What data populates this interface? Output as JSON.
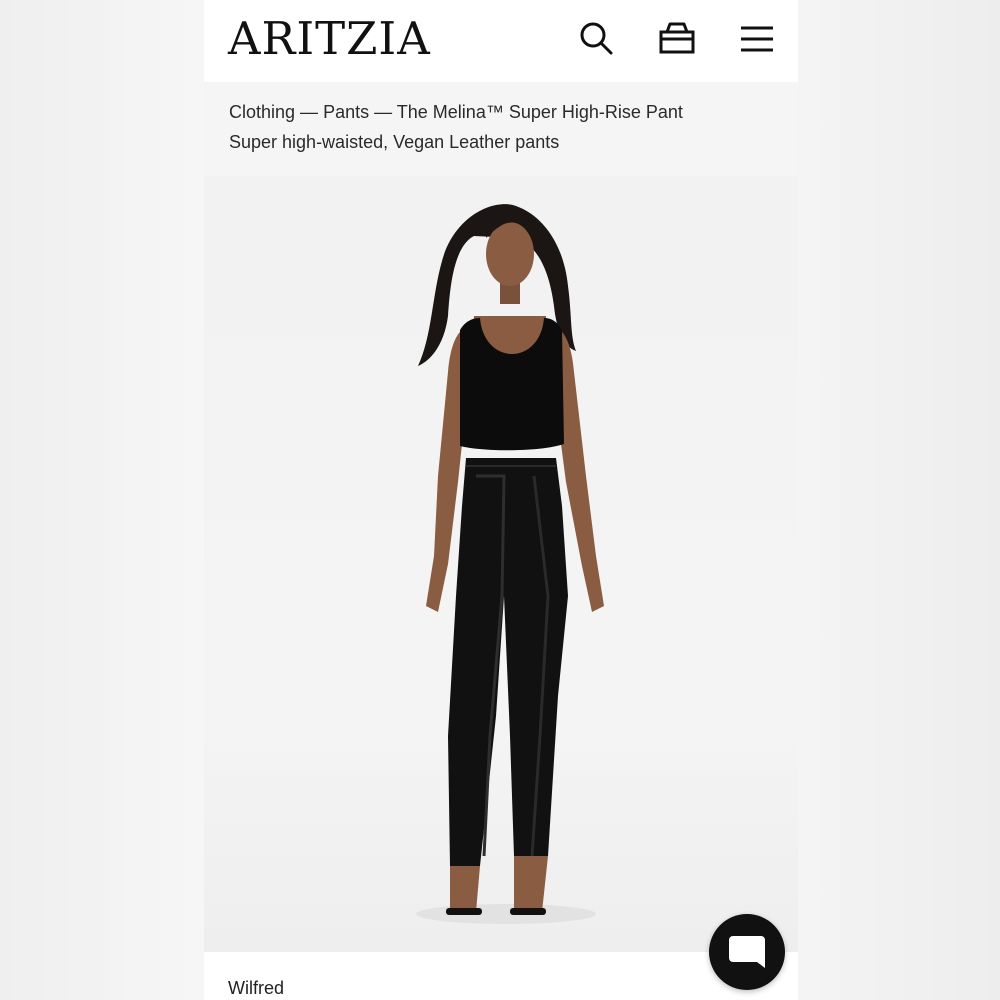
{
  "header": {
    "logo": "ARITZIA"
  },
  "breadcrumb": {
    "items": [
      "Clothing",
      "Pants",
      "The Melina™ Super High-Rise Pant"
    ],
    "separator": " — ",
    "description": "Super high-waisted, Vegan Leather pants"
  },
  "product": {
    "brand": "Wilfred"
  },
  "icons": [
    "search-icon",
    "bag-icon",
    "menu-icon",
    "chat-icon"
  ],
  "colors": {
    "text": "#111111",
    "header_bg": "#ffffff",
    "chat_button": "#111111"
  }
}
